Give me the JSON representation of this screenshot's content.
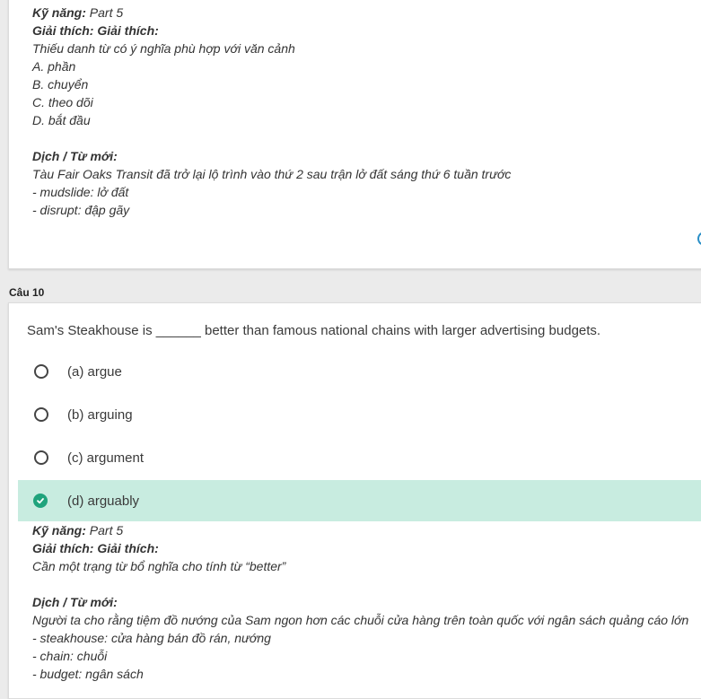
{
  "top_explanation": {
    "skill_label": "Kỹ năng:",
    "skill_value": "Part 5",
    "explain_heading": "Giải thích: Giải thích:",
    "explain_text": "Thiếu danh từ có ý nghĩa phù hợp với văn cảnh",
    "choices": [
      "A. phần",
      "B. chuyển",
      "C. theo dõi",
      "D. bắt đầu"
    ],
    "translation_heading": "Dịch / Từ mới:",
    "translation_text": "Tàu Fair Oaks Transit đã trở lại lộ trình vào thứ 2 sau trận lở đất sáng thứ 6 tuần trước",
    "vocab": [
      "- mudslide: lở đất",
      "- disrupt: đập gãy"
    ]
  },
  "question": {
    "label": "Câu 10",
    "text": "Sam's Steakhouse is ______ better than famous national chains with larger advertising budgets.",
    "options": [
      {
        "label": "(a) argue",
        "selected": false
      },
      {
        "label": "(b) arguing",
        "selected": false
      },
      {
        "label": "(c) argument",
        "selected": false
      },
      {
        "label": "(d) arguably",
        "selected": true
      }
    ]
  },
  "q10_explanation": {
    "skill_label": "Kỹ năng:",
    "skill_value": "Part 5",
    "explain_heading": "Giải thích: Giải thích:",
    "explain_text": "Cần một trạng từ bổ nghĩa cho tính từ “better”",
    "translation_heading": "Dịch / Từ mới:",
    "translation_text": "Người ta cho rằng tiệm đồ nướng của Sam ngon hơn các chuỗi cửa hàng trên toàn quốc với ngân sách quảng cáo lớn",
    "vocab": [
      "- steakhouse: cửa hàng bán đồ rán, nướng",
      "- chain: chuỗi",
      "- budget: ngân sách"
    ]
  },
  "colors": {
    "correct_bg": "#c8ece0",
    "check_green": "#1fa37c",
    "page_bg": "#ebebeb"
  },
  "icons": {
    "radio": "radio-empty-icon",
    "correct": "check-circle-icon"
  }
}
